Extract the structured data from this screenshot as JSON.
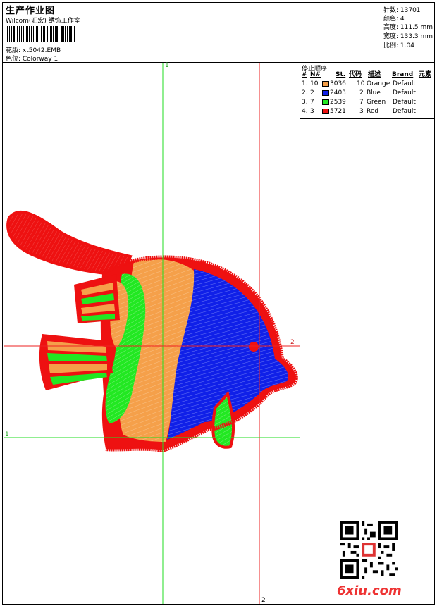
{
  "header": {
    "title": "生产作业图",
    "company": "Wilcom(汇宏) 绣饰工作室",
    "design_label": "花版: xt5042.EMB",
    "colorway_label": "色位: Colorway 1"
  },
  "stats": {
    "stitches": "针数: 13701",
    "colors": "颜色: 4",
    "height": "高度: 111.5 mm",
    "width": "宽度: 133.3 mm",
    "scale": "比例: 1.04"
  },
  "stop_sequence": {
    "title": "停止顺序:",
    "headers": {
      "num": "#",
      "n": "N#",
      "st": "St.",
      "code": "代码",
      "desc": "描述",
      "brand": "Brand",
      "elem": "元素"
    },
    "rows": [
      {
        "num": "1.",
        "n": "10",
        "swatch": "#f5a04a",
        "st": "3036",
        "code": "10",
        "desc": "Orange",
        "brand": "Default"
      },
      {
        "num": "2.",
        "n": "2",
        "swatch": "#1020e8",
        "st": "2403",
        "code": "2",
        "desc": "Blue",
        "brand": "Default"
      },
      {
        "num": "3.",
        "n": "7",
        "swatch": "#22e822",
        "st": "2539",
        "code": "7",
        "desc": "Green",
        "brand": "Default"
      },
      {
        "num": "4.",
        "n": "3",
        "swatch": "#ee1111",
        "st": "5721",
        "code": "3",
        "desc": "Red",
        "brand": "Default"
      }
    ]
  },
  "axes": {
    "v_green_label": "1",
    "h_red_label": "2",
    "h_green_label": "1",
    "v_red_label": "2"
  },
  "colors": {
    "orange": "#f5a04a",
    "blue": "#1020e8",
    "green": "#22e822",
    "red": "#ee1111",
    "guide_green": "#22dd22",
    "guide_red": "#ee2222"
  },
  "watermark": "6xiu.com"
}
